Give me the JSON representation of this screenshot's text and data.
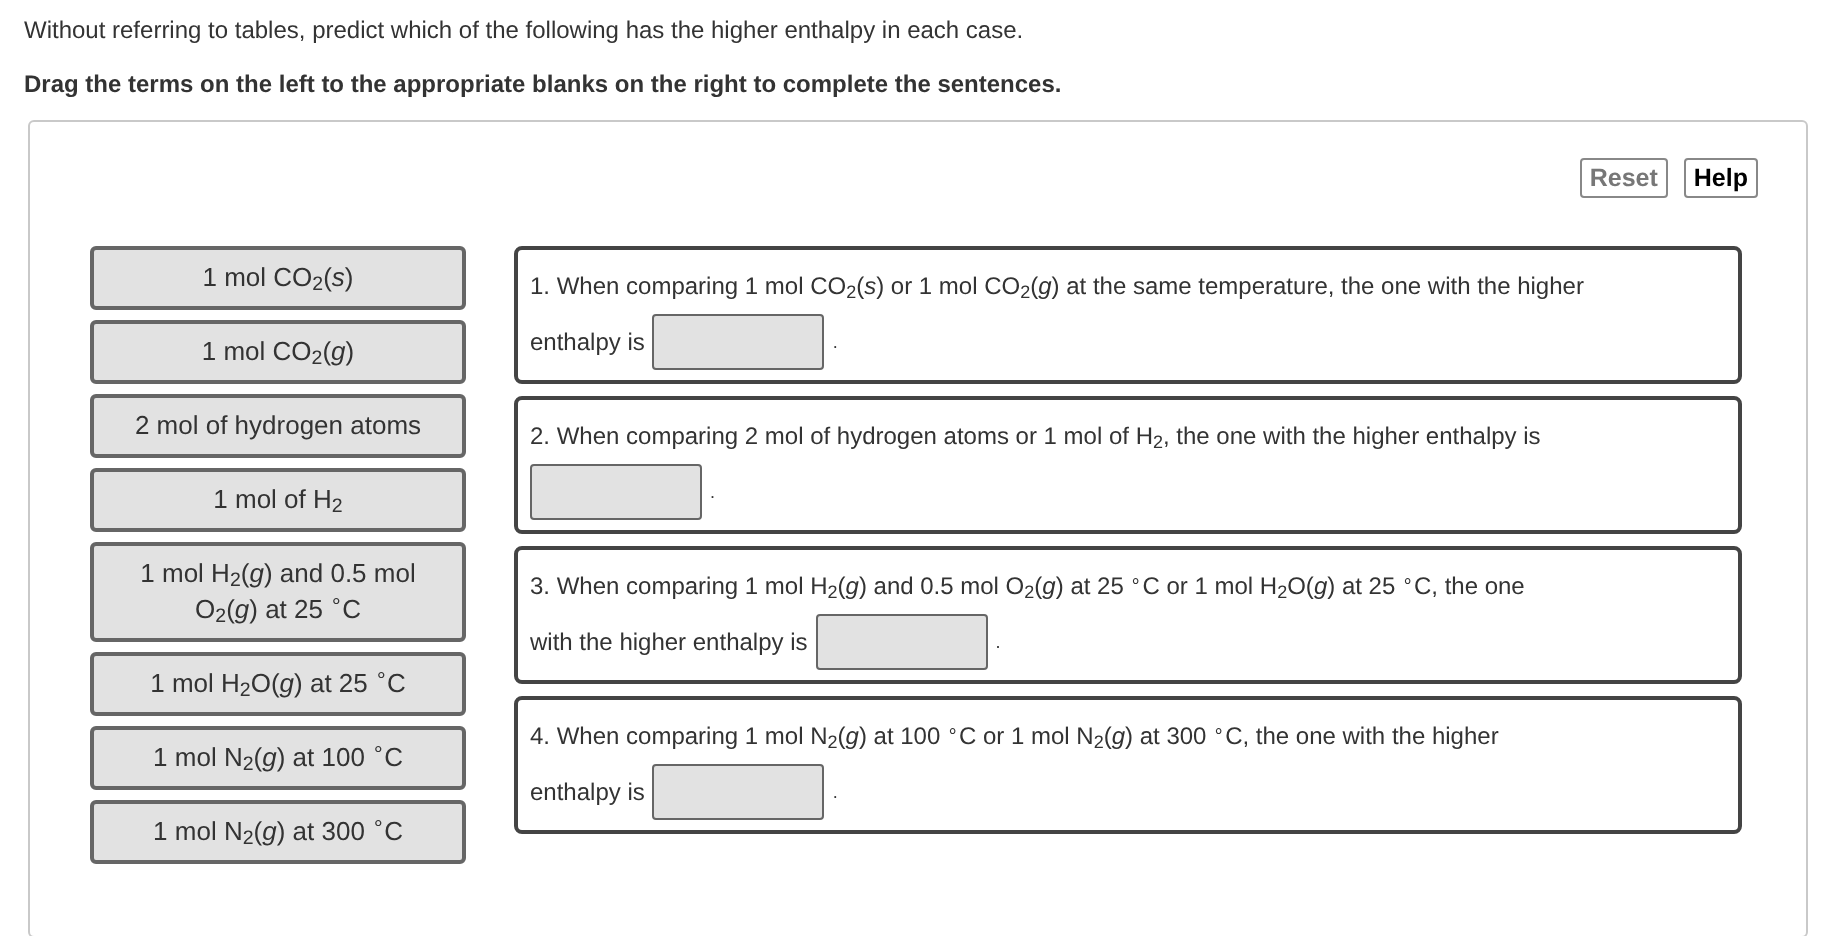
{
  "instructions": [
    "Without referring to tables, predict which of the following has the higher enthalpy in each case.",
    "Drag the terms on the left to the appropriate blanks on the right to complete the sentences."
  ],
  "buttons": [
    {
      "label": "Reset",
      "disabled": true
    },
    {
      "label": "Help",
      "disabled": false
    }
  ],
  "terms": [
    "1 mol CO$_{2}$(*s*)",
    "1 mol CO$_{2}$(*g*)",
    "2 mol of hydrogen atoms",
    "1 mol of H$_{2}$",
    "1 mol H$_{2}$(*g*) and 0.5 mol O$_{2}$(*g*) at 25 $^{∘}$C",
    "1 mol H$_{2}$O(*g*) at 25 $^{∘}$C",
    "1 mol N$_{2}$(*g*) at 100 $^{∘}$C",
    "1 mol N$_{2}$(*g*) at 300 $^{∘}$C"
  ],
  "sentences": [
    {
      "line_1": "1. When comparing 1 mol CO$_{2}$(*s*) or 1 mol CO$_{2}$(*g*) at the same temperature, the one with the higher",
      "line_2": "enthalpy is",
      "after": "."
    },
    {
      "line_1": "2. When comparing 2 mol of hydrogen atoms or 1 mol of H$_{2}$, the one with the higher enthalpy is",
      "after": "."
    },
    {
      "line_1": "3. When comparing 1 mol H$_{2}$(*g*) and 0.5 mol O$_{2}$(*g*) at 25 $^{∘}$C or 1 mol H$_{2}$O(*g*) at 25 $^{∘}$C, the one",
      "line_2": "with the higher enthalpy is",
      "after": "."
    },
    {
      "line_1": "4. When comparing 1 mol N$_{2}$(*g*) at 100 $^{∘}$C or 1 mol N$_{2}$(*g*) at 300 $^{∘}$C, the one with the higher",
      "line_2": "enthalpy is",
      "after": "."
    }
  ]
}
